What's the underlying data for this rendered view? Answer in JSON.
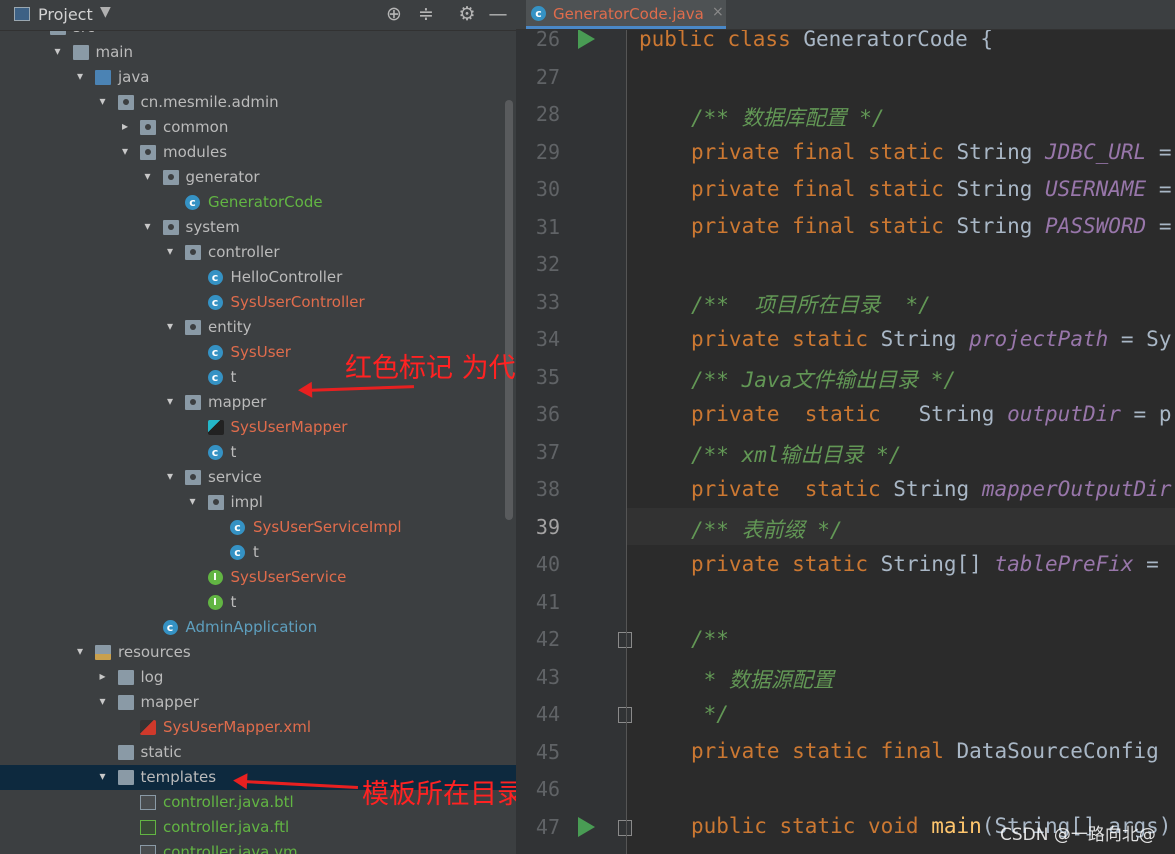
{
  "project_panel": {
    "title": "Project",
    "tree": [
      {
        "label": "src",
        "arrow": "▾",
        "icon": "folder",
        "color": "plain"
      },
      {
        "label": "main",
        "arrow": "▾",
        "icon": "folder",
        "color": "plain"
      },
      {
        "label": "java",
        "arrow": "▾",
        "icon": "folder-src",
        "color": "plain"
      },
      {
        "label": "cn.mesmile.admin",
        "arrow": "▾",
        "icon": "package",
        "color": "plain"
      },
      {
        "label": "common",
        "arrow": "▸",
        "icon": "package",
        "color": "plain"
      },
      {
        "label": "modules",
        "arrow": "▾",
        "icon": "package",
        "color": "plain"
      },
      {
        "label": "generator",
        "arrow": "▾",
        "icon": "package",
        "color": "plain"
      },
      {
        "label": "GeneratorCode",
        "arrow": "",
        "icon": "class-run",
        "color": "green"
      },
      {
        "label": "system",
        "arrow": "▾",
        "icon": "package",
        "color": "plain"
      },
      {
        "label": "controller",
        "arrow": "▾",
        "icon": "package",
        "color": "plain"
      },
      {
        "label": "HelloController",
        "arrow": "",
        "icon": "class",
        "color": "plain"
      },
      {
        "label": "SysUserController",
        "arrow": "",
        "icon": "class",
        "color": "red"
      },
      {
        "label": "entity",
        "arrow": "▾",
        "icon": "package",
        "color": "plain"
      },
      {
        "label": "SysUser",
        "arrow": "",
        "icon": "class",
        "color": "red"
      },
      {
        "label": "t",
        "arrow": "",
        "icon": "class",
        "color": "plain"
      },
      {
        "label": "mapper",
        "arrow": "▾",
        "icon": "package",
        "color": "plain"
      },
      {
        "label": "SysUserMapper",
        "arrow": "",
        "icon": "mapper",
        "color": "red"
      },
      {
        "label": "t",
        "arrow": "",
        "icon": "class",
        "color": "plain"
      },
      {
        "label": "service",
        "arrow": "▾",
        "icon": "package",
        "color": "plain"
      },
      {
        "label": "impl",
        "arrow": "▾",
        "icon": "package",
        "color": "plain"
      },
      {
        "label": "SysUserServiceImpl",
        "arrow": "",
        "icon": "class",
        "color": "red"
      },
      {
        "label": "t",
        "arrow": "",
        "icon": "class",
        "color": "plain"
      },
      {
        "label": "SysUserService",
        "arrow": "",
        "icon": "interface",
        "color": "red"
      },
      {
        "label": "t",
        "arrow": "",
        "icon": "interface",
        "color": "plain"
      },
      {
        "label": "AdminApplication",
        "arrow": "",
        "icon": "class-boot",
        "color": "teal"
      },
      {
        "label": "resources",
        "arrow": "▾",
        "icon": "folder-res",
        "color": "plain"
      },
      {
        "label": "log",
        "arrow": "▸",
        "icon": "folder",
        "color": "plain"
      },
      {
        "label": "mapper",
        "arrow": "▾",
        "icon": "folder",
        "color": "plain"
      },
      {
        "label": "SysUserMapper.xml",
        "arrow": "",
        "icon": "xml",
        "color": "red"
      },
      {
        "label": "static",
        "arrow": "",
        "icon": "folder",
        "color": "plain"
      },
      {
        "label": "templates",
        "arrow": "▾",
        "icon": "folder",
        "color": "plain",
        "selected": true
      },
      {
        "label": "controller.java.btl",
        "arrow": "",
        "icon": "file",
        "color": "green"
      },
      {
        "label": "controller.java.ftl",
        "arrow": "",
        "icon": "ftl",
        "color": "green"
      },
      {
        "label": "controller.java.vm",
        "arrow": "",
        "icon": "file",
        "color": "green"
      }
    ]
  },
  "annotations": {
    "new_code": "红色标记 为代码新增代码",
    "templates_dir": "模板所在目录"
  },
  "editor": {
    "tab_label": "GeneratorCode.java",
    "current_line": "39",
    "lines": [
      {
        "n": "26",
        "run": true
      },
      {
        "n": "27"
      },
      {
        "n": "28"
      },
      {
        "n": "29"
      },
      {
        "n": "30"
      },
      {
        "n": "31"
      },
      {
        "n": "32"
      },
      {
        "n": "33"
      },
      {
        "n": "34"
      },
      {
        "n": "35"
      },
      {
        "n": "36"
      },
      {
        "n": "37"
      },
      {
        "n": "38"
      },
      {
        "n": "39"
      },
      {
        "n": "40"
      },
      {
        "n": "41"
      },
      {
        "n": "42",
        "fold": true
      },
      {
        "n": "43"
      },
      {
        "n": "44",
        "fold": true
      },
      {
        "n": "45"
      },
      {
        "n": "46"
      },
      {
        "n": "47",
        "run": true,
        "fold": true
      }
    ],
    "code": {
      "l26_kw": "public class ",
      "l26_rest": "GeneratorCode {",
      "l28": "/** 数据库配置 */",
      "l29_kw": "private final static ",
      "l29_type": "String ",
      "l29_fld": "JDBC_URL",
      "l29_rest": " =",
      "l30_kw": "private final static ",
      "l30_type": "String ",
      "l30_fld": "USERNAME",
      "l30_rest": " =",
      "l31_kw": "private final static ",
      "l31_type": "String ",
      "l31_fld": "PASSWORD",
      "l31_rest": " =",
      "l33": "/**  项目所在目录  */",
      "l34_kw": "private static ",
      "l34_type": "String ",
      "l34_fld": "projectPath",
      "l34_rest": " = Sy",
      "l35": "/** Java文件输出目录 */",
      "l36_kw": "private  static   ",
      "l36_type": "String ",
      "l36_fld": "outputDir",
      "l36_rest": " = p",
      "l37": "/** xml输出目录 */",
      "l38_kw": "private  static ",
      "l38_type": "String ",
      "l38_fld": "mapperOutputDir",
      "l39": "/** 表前缀 */",
      "l40_kw": "private static ",
      "l40_type": "String[] ",
      "l40_fld": "tablePreFix",
      "l40_rest": " =",
      "l42": "/**",
      "l43": " * 数据源配置",
      "l44": " */",
      "l45_kw": "private static final ",
      "l45_rest": "DataSourceConfig",
      "l47_kw": "public static void ",
      "l47_fn": "main",
      "l47_rest": "(String[] args)"
    }
  },
  "watermark": "CSDN @一路向北@"
}
